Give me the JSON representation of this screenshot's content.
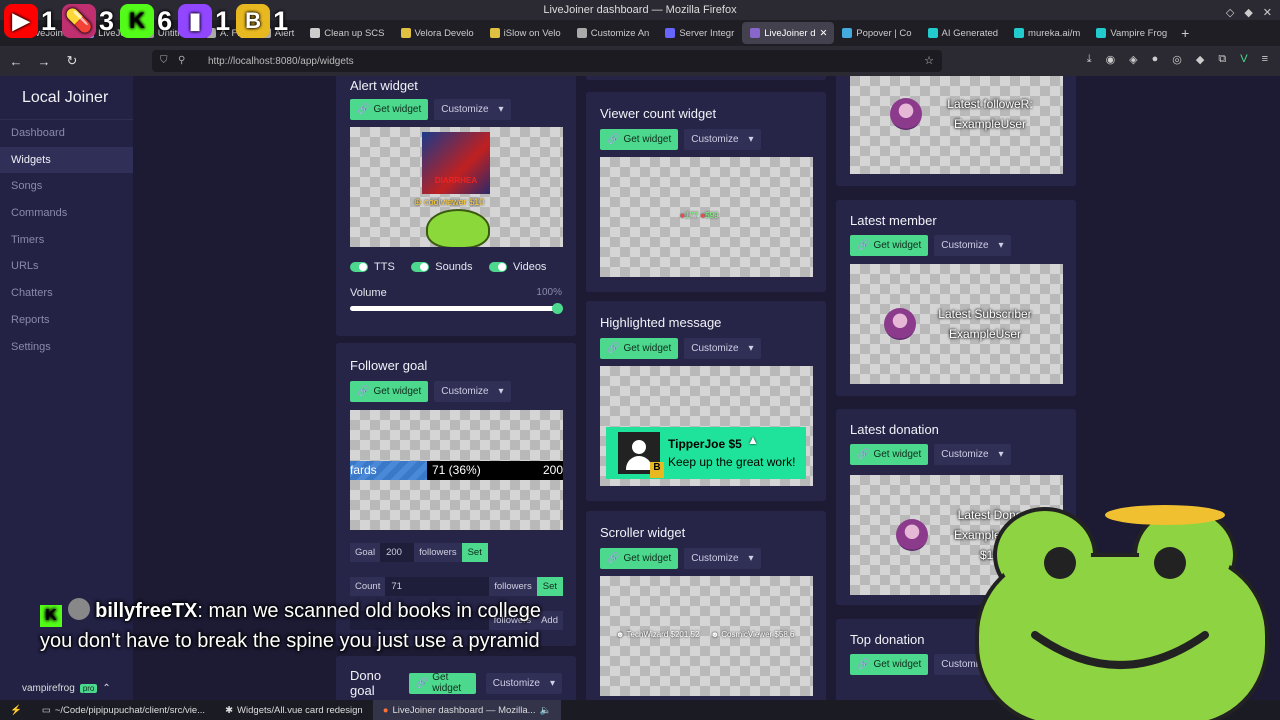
{
  "browser": {
    "window_title": "LiveJoiner dashboard — Mozilla Firefox",
    "url": "http://localhost:8080/app/widgets",
    "tabs": [
      {
        "label": "LiveJoine",
        "color": "#e4405f"
      },
      {
        "label": "LiveJoi",
        "color": "#8888ff"
      },
      {
        "label": "Untitled",
        "color": "#999"
      },
      {
        "label": "A. Fig",
        "color": "#aaa"
      },
      {
        "label": "Alert",
        "color": "#aaa"
      },
      {
        "label": "Clean up SCS",
        "color": "#ccc"
      },
      {
        "label": "Velora Develo",
        "color": "#e0c040"
      },
      {
        "label": "iSlow on Velo",
        "color": "#e0c040"
      },
      {
        "label": "Customize An",
        "color": "#aaa"
      },
      {
        "label": "Server Integr",
        "color": "#6666ff"
      },
      {
        "label": "LiveJoiner d",
        "color": "#8866cc"
      },
      {
        "label": "Popover | Co",
        "color": "#44aadd"
      },
      {
        "label": "AI Generated",
        "color": "#22cccc"
      },
      {
        "label": "mureka.ai/m",
        "color": "#22cccc"
      },
      {
        "label": "Vampire Frog",
        "color": "#22cccc"
      }
    ]
  },
  "overlay_stats": [
    {
      "icon": "youtube-icon",
      "count": "1",
      "color": "#ff0000",
      "glyph": "▶"
    },
    {
      "icon": "pill-icon",
      "count": "3",
      "color": "#c03070",
      "glyph": "💊"
    },
    {
      "icon": "kick-icon",
      "count": "6",
      "color": "#53fc18",
      "glyph": "K"
    },
    {
      "icon": "twitch-icon",
      "count": "1",
      "color": "#9146ff",
      "glyph": "▮"
    },
    {
      "icon": "bits-icon",
      "count": "1",
      "color": "#e8b820",
      "glyph": "B"
    }
  ],
  "sidebar": {
    "brand": "Local Joiner",
    "items": [
      "Dashboard",
      "Widgets",
      "Songs",
      "Commands",
      "Timers",
      "URLs",
      "Chatters",
      "Reports",
      "Settings"
    ],
    "active_index": 1
  },
  "buttons": {
    "get_widget": "Get widget",
    "customize": "Customize"
  },
  "alert_widget": {
    "title": "Alert widget",
    "preview_text": "coolviewer $10",
    "banner": "DIARRHEA",
    "toggles": [
      "TTS",
      "Sounds",
      "Videos"
    ],
    "volume_label": "Volume",
    "volume_value": "100%",
    "volume_level": 1.0
  },
  "follower_goal": {
    "title": "Follower goal",
    "bar_label": "fards",
    "bar_value": "71 (36%)",
    "bar_target": "200",
    "progress": 0.36,
    "goal_label": "Goal",
    "goal_value": "200",
    "goal_unit": "followers",
    "set_label": "Set",
    "count_label": "Count",
    "count_value": "71",
    "count_unit": "followers",
    "add_unit": "followers",
    "add_label": "Add"
  },
  "dono_goal": {
    "title": "Dono goal"
  },
  "viewer_count": {
    "title": "Viewer count widget",
    "a": "177",
    "b": "599"
  },
  "highlighted": {
    "title": "Highlighted message",
    "name": "TipperJoe $5",
    "message": "Keep up the great work!"
  },
  "scroller": {
    "title": "Scroller widget",
    "item1": "TechWizard $201.52",
    "item2": "CosmicViewer $58.6"
  },
  "latest_follower": {
    "line1": "Latest followeR:",
    "line2": "ExampleUser"
  },
  "latest_member": {
    "title": "Latest member",
    "line1": "Latest Subscriber",
    "line2": "ExampleUser"
  },
  "latest_donation": {
    "title": "Latest donation",
    "line1": "Latest Dono",
    "line2": "ExampleUser",
    "line3": "$10"
  },
  "top_donation": {
    "title": "Top donation"
  },
  "chat": {
    "user": "billyfreeTX",
    "message": ": man we scanned old books in college you don't have to break the spine you just use a pyramid"
  },
  "streamer": {
    "name": "vampirefrog",
    "badge": "pro"
  },
  "taskbar": [
    "~/Code/pipipupuchat/client/src/vie...",
    "Widgets/All.vue card redesign",
    "LiveJoiner dashboard — Mozilla..."
  ]
}
